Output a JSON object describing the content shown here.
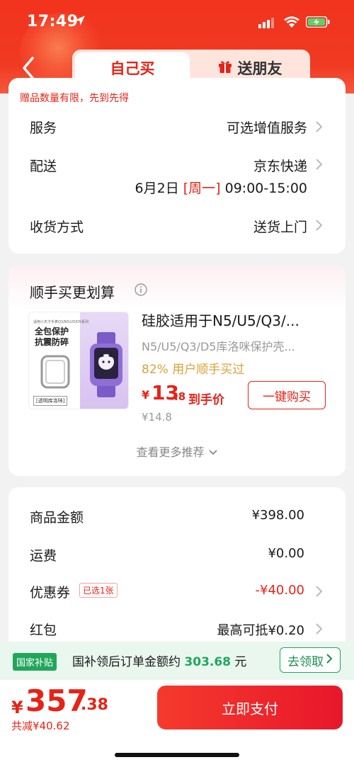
{
  "status_bar": {
    "time": "17:49"
  },
  "header": {
    "tab_self": "自己买",
    "tab_gift": "送朋友"
  },
  "order_info": {
    "notice": "赠品数量有限，先到先得",
    "service_label": "服务",
    "service_value": "可选增值服务",
    "delivery_label": "配送",
    "delivery_value": "京东快递",
    "delivery_date": "6月2日",
    "delivery_weekday": "[周一]",
    "delivery_time": "09:00-15:00",
    "receive_label": "收货方式",
    "receive_value": "送货上门"
  },
  "recommend": {
    "title": "顺手买更划算",
    "image_caption": "适用小天才手表Q3/N5/U5/D5系列",
    "image_headline": "全包保护 抗震防碎",
    "image_tag": "[透明库洛咪]",
    "product_title": "硅胶适用于N5/U5/Q3/...",
    "product_subtitle": "N5/U5/Q3/D5库洛咪保护壳...",
    "buy_rate": "82% 用户顺手买过",
    "currency": "¥",
    "price_int": "13",
    "price_dec": ".8",
    "price_tag": "到手价",
    "old_price": "¥14.8",
    "buy_button": "一键购买",
    "more": "查看更多推荐"
  },
  "summary": {
    "goods_label": "商品金额",
    "goods_value": "¥398.00",
    "shipping_label": "运费",
    "shipping_value": "¥0.00",
    "coupon_label": "优惠券",
    "coupon_badge": "已选1张",
    "coupon_value": "-¥40.00",
    "redpacket_label": "红包",
    "redpacket_value": "最高可抵¥0.20"
  },
  "subsidy": {
    "badge": "国家补贴",
    "text_prefix": "国补领后订单金额约",
    "amount": "303.68",
    "text_suffix": "元",
    "button": "去领取"
  },
  "footer": {
    "currency": "¥",
    "total_int": "357",
    "total_dec": ".38",
    "saved": "共减¥40.62",
    "pay_button": "立即支付"
  },
  "colors": {
    "brand_red": "#e62317",
    "subsidy_green": "#21a65b",
    "gold": "#d8a23a"
  }
}
